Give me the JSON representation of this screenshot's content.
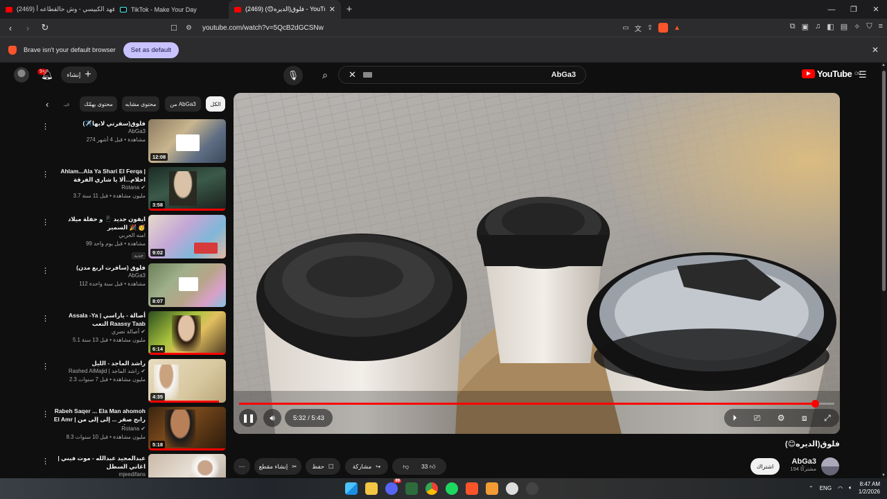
{
  "browser": {
    "tabs": [
      {
        "title": "(2469) فهد الكبيسي - وش حالقطاعه أ",
        "active": false
      },
      {
        "title": "TikTok - Make Your Day",
        "active": false
      },
      {
        "title": "(2469) فلوق(الديره😊) - YouTube",
        "active": true
      }
    ],
    "url": "youtube.com/watch?v=5QcB2dGCSNw",
    "shields_count": "1",
    "infobar_text": "Brave isn't your default browser",
    "infobar_button": "Set as default"
  },
  "masthead": {
    "notifications_badge": "9+",
    "create_label": "إنشاء",
    "search_query": "AbGa3",
    "logo_text": "YouTube",
    "logo_country": "OM"
  },
  "chips": [
    "الكل",
    "من AbGa3",
    "محتوى مشابه",
    "محتوى يهمّك",
    "فيـ"
  ],
  "recommendations": [
    {
      "title": "فلوق(سفرتي لابها✈️)",
      "channel": "AbGa3",
      "views": "274 مشاهدة • قبل 4 أشهر",
      "duration": "12:08",
      "verified": false,
      "new": false
    },
    {
      "title": "Ahlam...Ala Ya Shari El Ferqa | احلام...ألا يا شاري الفرقة",
      "channel": "Rotana",
      "views": "3.7 مليون مشاهدة • قبل 11 سنة",
      "duration": "3:58",
      "verified": true,
      "new": false
    },
    {
      "title": "ايفون جديد 📱 و حفلة ميلاد السمير 🎉 🥳",
      "channel": "امنه الحربي",
      "views": "99 مشاهدة • قبل يوم واحد",
      "duration": "9:02",
      "verified": false,
      "new": true,
      "new_label": "جديد"
    },
    {
      "title": "فلوق (سافرت اربع مدن)",
      "channel": "AbGa3",
      "views": "112 مشاهدة • قبل سنة واحدة",
      "duration": "8:07",
      "verified": false,
      "new": false
    },
    {
      "title": "Assala -Ya | أصالة - ياراسي التعب Raassy Taab",
      "channel": "أصالة نصري",
      "views": "5.1 مليون مشاهدة • قبل 13 سنة",
      "duration": "6:14",
      "verified": true,
      "new": false
    },
    {
      "title": "راشد الماجد - الليل",
      "channel": "Rashed AlMajid | راشد الماجد",
      "views": "2.3 مليون مشاهدة • قبل 7 سنوات",
      "duration": "4:35",
      "verified": true,
      "new": false
    },
    {
      "title": "Rabeh Saqer ... Ela Man ahomoh El Amr | رابح صقر ... إلى إلى من يهمه الأمر",
      "channel": "Rotana",
      "views": "8.3 مليون مشاهدة • قبل 10 سنوات",
      "duration": "5:18",
      "verified": true,
      "new": false
    },
    {
      "title": "عبدالمجيد عبدالله - موت فيني | اغاني السطل",
      "channel": "mjeedifans",
      "views": "",
      "duration": "",
      "verified": false,
      "new": false
    }
  ],
  "player": {
    "current_time": "5:32",
    "total_time": "5:43",
    "time_text": "5:32 / 5:43",
    "progress": 0.967
  },
  "video": {
    "title": "فلوق(الديره😊)",
    "channel": "AbGa3",
    "subscribers": "194 مشتركًا",
    "subscribe_label": "اشتراك",
    "likes": "33",
    "share_label": "مشاركة",
    "save_label": "حفظ",
    "clip_label": "إنشاء مقطع"
  },
  "taskbar": {
    "time": "8:47 AM",
    "date": "1/2/2026",
    "lang": "ENG",
    "discord_badge": "99"
  },
  "colors": {
    "accent_red": "#ff0000",
    "brave_orange": "#fb542b",
    "default_button": "#c8c2ff"
  }
}
